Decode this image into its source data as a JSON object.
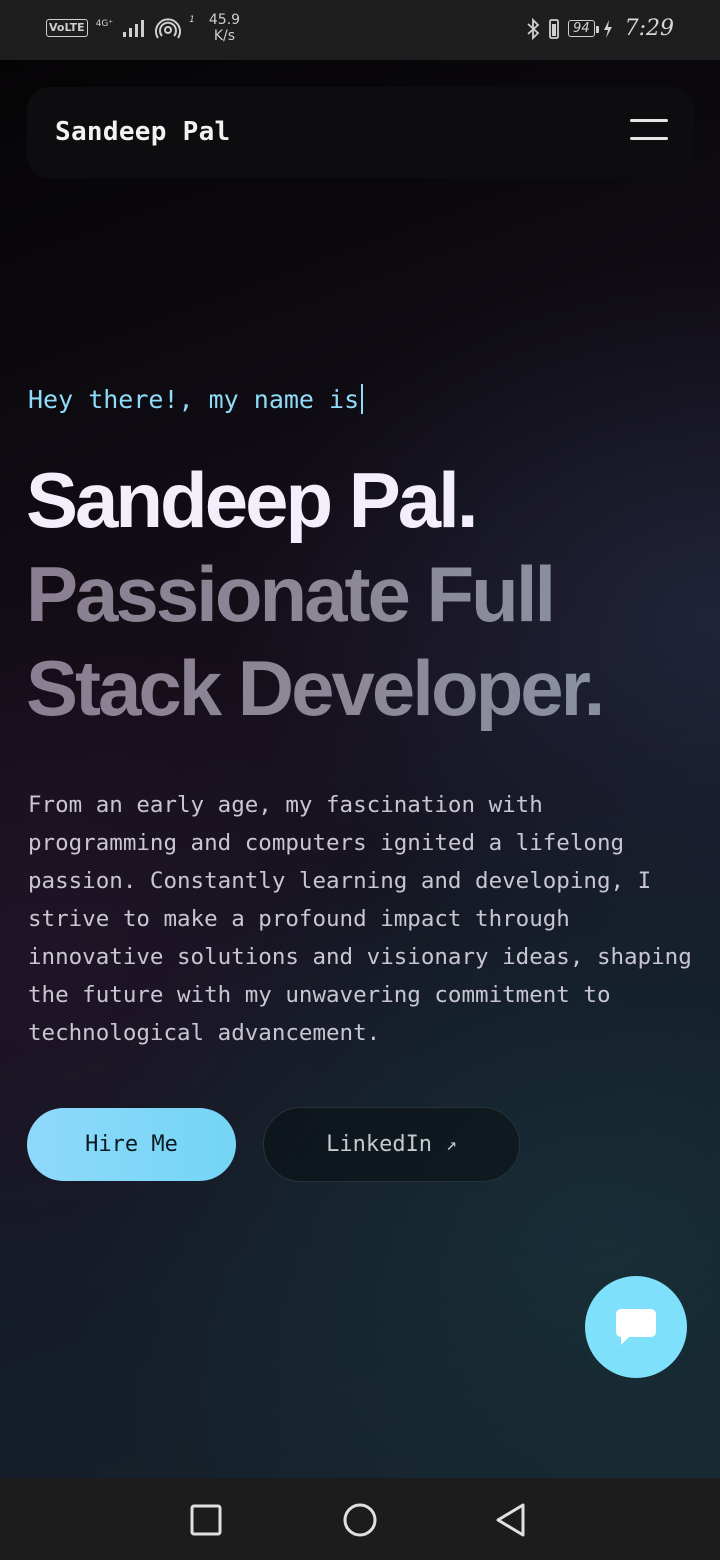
{
  "status_bar": {
    "volte": "VoLTE",
    "network": "4G⁺",
    "hotspot_badge": "1",
    "speed_value": "45.9",
    "speed_unit": "K/s",
    "battery": "94",
    "time": "7:29",
    "icons": [
      "signal-icon",
      "hotspot-icon",
      "bluetooth-icon",
      "vibrate-icon",
      "battery-icon",
      "charging-icon"
    ]
  },
  "navbar": {
    "brand": "Sandeep Pal",
    "menu_icon": "hamburger-menu-icon"
  },
  "hero": {
    "greeting": "Hey there!, my name is",
    "name": "Sandeep Pal.",
    "tagline_line1": "Passionate Full",
    "tagline_line2": "Stack Developer.",
    "bio": "From an early age, my fascination with programming and computers ignited a lifelong passion. Constantly learning and developing, I strive to make a profound impact through innovative solutions and visionary ideas, shaping the future with my unwavering commitment to technological advancement."
  },
  "actions": {
    "hire_label": "Hire Me",
    "linkedin_label": "LinkedIn",
    "linkedin_icon": "external-arrow-icon"
  },
  "chat": {
    "icon": "chat-bubble-icon"
  },
  "android_nav": {
    "icons": [
      "recents-square-icon",
      "home-circle-icon",
      "back-triangle-icon"
    ]
  },
  "colors": {
    "accent": "#8fdcf8",
    "name": "#f4eefb",
    "tagline": "#8c8896",
    "bio": "#c9c6d2",
    "fab": "#7fe0fb"
  }
}
